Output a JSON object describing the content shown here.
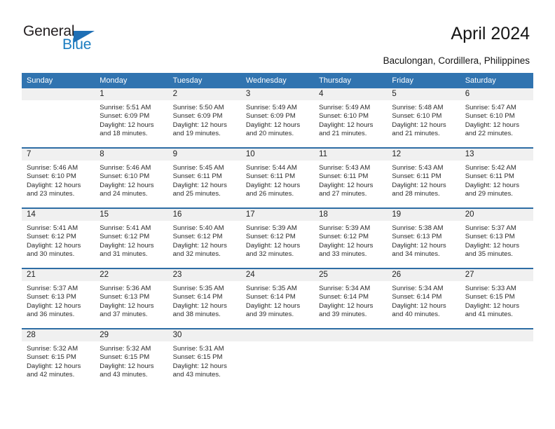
{
  "brand": {
    "word_one": "General",
    "word_two": "Blue",
    "triangle_icon": "triangle-icon"
  },
  "header": {
    "title": "April 2024",
    "location": "Baculongan, Cordillera, Philippines",
    "accent_color": "#3174b0",
    "band_color": "#f0f0f0",
    "divider_color": "#2e6da4"
  },
  "weekday_headers": [
    "Sunday",
    "Monday",
    "Tuesday",
    "Wednesday",
    "Thursday",
    "Friday",
    "Saturday"
  ],
  "labels": {
    "sunrise_prefix": "Sunrise:",
    "sunset_prefix": "Sunset:",
    "daylight_prefix": "Daylight:"
  },
  "weeks": [
    [
      {
        "day": "",
        "empty": true,
        "line1": "",
        "line2": "",
        "line3": "",
        "line4": ""
      },
      {
        "day": "1",
        "line1": "Sunrise: 5:51 AM",
        "line2": "Sunset: 6:09 PM",
        "line3": "Daylight: 12 hours",
        "line4": "and 18 minutes."
      },
      {
        "day": "2",
        "line1": "Sunrise: 5:50 AM",
        "line2": "Sunset: 6:09 PM",
        "line3": "Daylight: 12 hours",
        "line4": "and 19 minutes."
      },
      {
        "day": "3",
        "line1": "Sunrise: 5:49 AM",
        "line2": "Sunset: 6:09 PM",
        "line3": "Daylight: 12 hours",
        "line4": "and 20 minutes."
      },
      {
        "day": "4",
        "line1": "Sunrise: 5:49 AM",
        "line2": "Sunset: 6:10 PM",
        "line3": "Daylight: 12 hours",
        "line4": "and 21 minutes."
      },
      {
        "day": "5",
        "line1": "Sunrise: 5:48 AM",
        "line2": "Sunset: 6:10 PM",
        "line3": "Daylight: 12 hours",
        "line4": "and 21 minutes."
      },
      {
        "day": "6",
        "line1": "Sunrise: 5:47 AM",
        "line2": "Sunset: 6:10 PM",
        "line3": "Daylight: 12 hours",
        "line4": "and 22 minutes."
      }
    ],
    [
      {
        "day": "7",
        "line1": "Sunrise: 5:46 AM",
        "line2": "Sunset: 6:10 PM",
        "line3": "Daylight: 12 hours",
        "line4": "and 23 minutes."
      },
      {
        "day": "8",
        "line1": "Sunrise: 5:46 AM",
        "line2": "Sunset: 6:10 PM",
        "line3": "Daylight: 12 hours",
        "line4": "and 24 minutes."
      },
      {
        "day": "9",
        "line1": "Sunrise: 5:45 AM",
        "line2": "Sunset: 6:11 PM",
        "line3": "Daylight: 12 hours",
        "line4": "and 25 minutes."
      },
      {
        "day": "10",
        "line1": "Sunrise: 5:44 AM",
        "line2": "Sunset: 6:11 PM",
        "line3": "Daylight: 12 hours",
        "line4": "and 26 minutes."
      },
      {
        "day": "11",
        "line1": "Sunrise: 5:43 AM",
        "line2": "Sunset: 6:11 PM",
        "line3": "Daylight: 12 hours",
        "line4": "and 27 minutes."
      },
      {
        "day": "12",
        "line1": "Sunrise: 5:43 AM",
        "line2": "Sunset: 6:11 PM",
        "line3": "Daylight: 12 hours",
        "line4": "and 28 minutes."
      },
      {
        "day": "13",
        "line1": "Sunrise: 5:42 AM",
        "line2": "Sunset: 6:11 PM",
        "line3": "Daylight: 12 hours",
        "line4": "and 29 minutes."
      }
    ],
    [
      {
        "day": "14",
        "line1": "Sunrise: 5:41 AM",
        "line2": "Sunset: 6:12 PM",
        "line3": "Daylight: 12 hours",
        "line4": "and 30 minutes."
      },
      {
        "day": "15",
        "line1": "Sunrise: 5:41 AM",
        "line2": "Sunset: 6:12 PM",
        "line3": "Daylight: 12 hours",
        "line4": "and 31 minutes."
      },
      {
        "day": "16",
        "line1": "Sunrise: 5:40 AM",
        "line2": "Sunset: 6:12 PM",
        "line3": "Daylight: 12 hours",
        "line4": "and 32 minutes."
      },
      {
        "day": "17",
        "line1": "Sunrise: 5:39 AM",
        "line2": "Sunset: 6:12 PM",
        "line3": "Daylight: 12 hours",
        "line4": "and 32 minutes."
      },
      {
        "day": "18",
        "line1": "Sunrise: 5:39 AM",
        "line2": "Sunset: 6:12 PM",
        "line3": "Daylight: 12 hours",
        "line4": "and 33 minutes."
      },
      {
        "day": "19",
        "line1": "Sunrise: 5:38 AM",
        "line2": "Sunset: 6:13 PM",
        "line3": "Daylight: 12 hours",
        "line4": "and 34 minutes."
      },
      {
        "day": "20",
        "line1": "Sunrise: 5:37 AM",
        "line2": "Sunset: 6:13 PM",
        "line3": "Daylight: 12 hours",
        "line4": "and 35 minutes."
      }
    ],
    [
      {
        "day": "21",
        "line1": "Sunrise: 5:37 AM",
        "line2": "Sunset: 6:13 PM",
        "line3": "Daylight: 12 hours",
        "line4": "and 36 minutes."
      },
      {
        "day": "22",
        "line1": "Sunrise: 5:36 AM",
        "line2": "Sunset: 6:13 PM",
        "line3": "Daylight: 12 hours",
        "line4": "and 37 minutes."
      },
      {
        "day": "23",
        "line1": "Sunrise: 5:35 AM",
        "line2": "Sunset: 6:14 PM",
        "line3": "Daylight: 12 hours",
        "line4": "and 38 minutes."
      },
      {
        "day": "24",
        "line1": "Sunrise: 5:35 AM",
        "line2": "Sunset: 6:14 PM",
        "line3": "Daylight: 12 hours",
        "line4": "and 39 minutes."
      },
      {
        "day": "25",
        "line1": "Sunrise: 5:34 AM",
        "line2": "Sunset: 6:14 PM",
        "line3": "Daylight: 12 hours",
        "line4": "and 39 minutes."
      },
      {
        "day": "26",
        "line1": "Sunrise: 5:34 AM",
        "line2": "Sunset: 6:14 PM",
        "line3": "Daylight: 12 hours",
        "line4": "and 40 minutes."
      },
      {
        "day": "27",
        "line1": "Sunrise: 5:33 AM",
        "line2": "Sunset: 6:15 PM",
        "line3": "Daylight: 12 hours",
        "line4": "and 41 minutes."
      }
    ],
    [
      {
        "day": "28",
        "line1": "Sunrise: 5:32 AM",
        "line2": "Sunset: 6:15 PM",
        "line3": "Daylight: 12 hours",
        "line4": "and 42 minutes."
      },
      {
        "day": "29",
        "line1": "Sunrise: 5:32 AM",
        "line2": "Sunset: 6:15 PM",
        "line3": "Daylight: 12 hours",
        "line4": "and 43 minutes."
      },
      {
        "day": "30",
        "line1": "Sunrise: 5:31 AM",
        "line2": "Sunset: 6:15 PM",
        "line3": "Daylight: 12 hours",
        "line4": "and 43 minutes."
      },
      {
        "day": "",
        "empty": true,
        "line1": "",
        "line2": "",
        "line3": "",
        "line4": ""
      },
      {
        "day": "",
        "empty": true,
        "line1": "",
        "line2": "",
        "line3": "",
        "line4": ""
      },
      {
        "day": "",
        "empty": true,
        "line1": "",
        "line2": "",
        "line3": "",
        "line4": ""
      },
      {
        "day": "",
        "empty": true,
        "line1": "",
        "line2": "",
        "line3": "",
        "line4": ""
      }
    ]
  ]
}
